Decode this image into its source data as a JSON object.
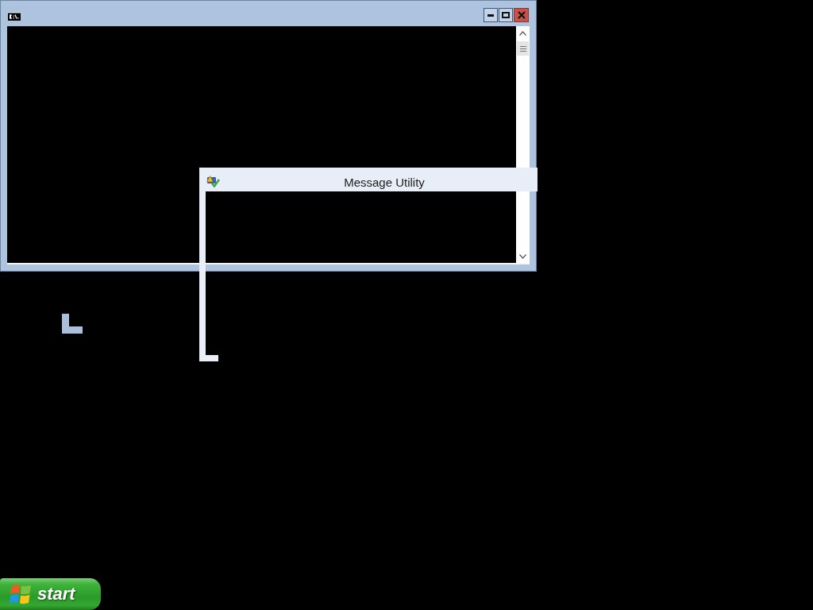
{
  "console_window": {
    "title_buttons": [
      {
        "kind": "minimize"
      },
      {
        "kind": "maximize"
      },
      {
        "kind": "close"
      }
    ]
  },
  "message_window": {
    "title": "Message Utility"
  },
  "taskbar": {
    "start_button": {
      "label": "start"
    }
  }
}
